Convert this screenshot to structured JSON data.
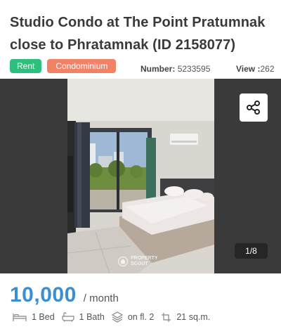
{
  "listing": {
    "title": "Studio Condo at The Point Pratumnak close to Phratamnak (ID 2158077)",
    "tags": {
      "rent": "Rent",
      "type": "Condominium"
    },
    "number_label": "Number:",
    "number_value": "5233595",
    "view_label": "View :",
    "view_value": "262"
  },
  "gallery": {
    "counter": "1/8",
    "watermark_line1": "PROPERTY",
    "watermark_line2": "SCOUT",
    "share_icon": "share-icon"
  },
  "price": {
    "amount": "10,000",
    "unit": "/ month"
  },
  "features": {
    "bed": "1 Bed",
    "bath": "1 Bath",
    "floor": "on fl. 2",
    "area": "21 sq.m."
  },
  "colors": {
    "rent_tag": "#2fbf7c",
    "condo_tag": "#f28266",
    "price": "#3b8fd0"
  }
}
